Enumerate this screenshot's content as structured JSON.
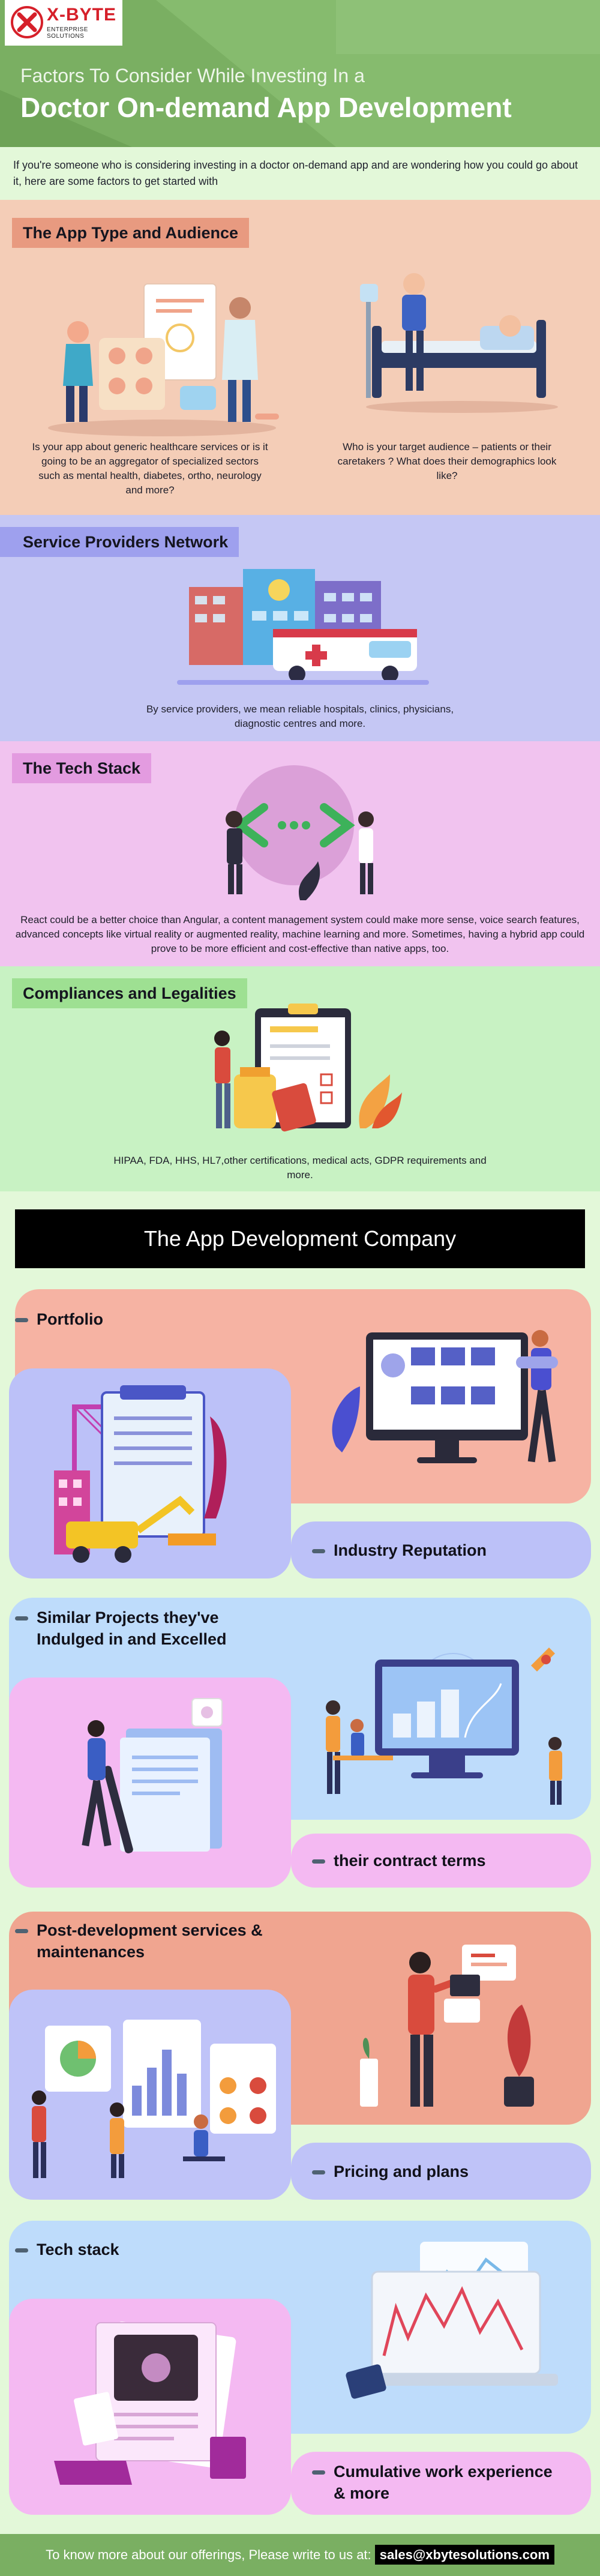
{
  "brand": {
    "logo_name": "X-BYTE",
    "logo_sub": "ENTERPRISE SOLUTIONS",
    "accent": "#d6202a",
    "header_bg": "#7aaf62"
  },
  "header": {
    "title_line1": "Factors To Consider While Investing In a",
    "title_line2": "Doctor On-demand App Development"
  },
  "intro": "If you're someone who is considering investing in a doctor on-demand app and are wondering how you could go about it, here are some factors to get started with",
  "sections": [
    {
      "title": "The App Type and Audience",
      "captions": [
        "Is your app about generic healthcare services or is it going to be an aggregator of specialized sectors such as mental health, diabetes, ortho, neurology and more?",
        "Who is your target audience – patients or their caretakers ? What does their demographics look like?"
      ],
      "bg": "#f4cdb7",
      "tag_bg": "#e89a80"
    },
    {
      "title": "Service Providers Network",
      "captions": [
        "By service providers, we mean reliable hospitals, clinics, physicians, diagnostic centres and more."
      ],
      "bg": "#c5c7f4",
      "tag_bg": "#9ea0ee"
    },
    {
      "title": "The Tech Stack",
      "captions": [
        "React could be a better choice than Angular, a content management system could make more sense, voice search features, advanced concepts like virtual reality or augmented reality, machine learning and more. Sometimes, having a hybrid app could prove to be more efficient and cost-effective than native apps, too."
      ],
      "bg": "#f1c3ef",
      "tag_bg": "#e39be0"
    },
    {
      "title": "Compliances and Legalities",
      "captions": [
        "HIPAA, FDA, HHS, HL7,other certifications, medical acts, GDPR requirements and more."
      ],
      "bg": "#c8f2c3",
      "tag_bg": "#9ee092"
    }
  ],
  "company": {
    "title": "The App Development Company",
    "items": [
      {
        "label": "Portfolio",
        "bg": "#f6b3a3"
      },
      {
        "label": "Industry Reputation",
        "bg": "#bcc1f8"
      },
      {
        "label_line1": "Similar Projects they've",
        "label_line2": "Indulged in and Excelled",
        "bg": "#bedcfb"
      },
      {
        "label": "their contract terms",
        "bg": "#f4b9f2"
      },
      {
        "label_line1": "Post-development services &",
        "label_line2": "maintenances",
        "bg": "#f0a590"
      },
      {
        "label": "Pricing and plans",
        "bg": "#bfc3f8"
      },
      {
        "label": "Tech stack",
        "bg": "#bedcfb"
      },
      {
        "label_line1": "Cumulative work experience",
        "label_line2": "& more",
        "bg": "#f4b9f2"
      }
    ]
  },
  "footer": {
    "text": "To know more about our offerings, Please write to us at:",
    "email": "sales@xbytesolutions.com"
  }
}
